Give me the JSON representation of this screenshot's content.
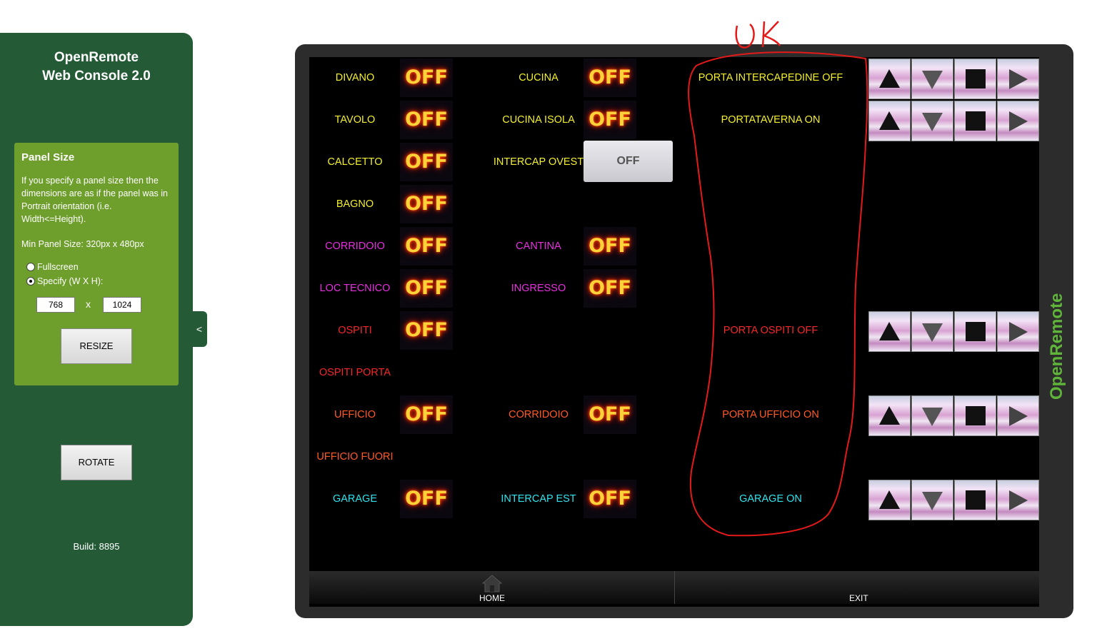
{
  "sidebar": {
    "title_line1": "OpenRemote",
    "title_line2": "Web Console 2.0",
    "panel_size": {
      "heading": "Panel Size",
      "description": "If you specify a panel size then the dimensions are as if the panel was in Portrait orientation (i.e. Width<=Height).",
      "min_size": "Min Panel Size: 320px x 480px",
      "option_fullscreen": "Fullscreen",
      "option_specify": "Specify (W X H):",
      "selected_option": "Specify (W X H):",
      "width_value": "768",
      "height_value": "1024",
      "times": "x",
      "resize_label": "RESIZE"
    },
    "rotate_label": "ROTATE",
    "build": "Build: 8895",
    "collapse_glyph": "<"
  },
  "rows": [
    {
      "color": "#f3ef2e",
      "left": {
        "label": "DIVANO",
        "state": "OFF"
      },
      "mid": {
        "label": "CUCINA",
        "state": "OFF"
      },
      "door": {
        "label": "PORTA INTERCAPEDINE OFF"
      },
      "controls": true
    },
    {
      "color": "#f3ef2e",
      "left": {
        "label": "TAVOLO",
        "state": "OFF"
      },
      "mid": {
        "label": "CUCINA ISOLA",
        "state": "OFF"
      },
      "door": {
        "label": "PORTATAVERNA ON"
      },
      "controls": true
    },
    {
      "color": "#f3ef2e",
      "left": {
        "label": "CALCETTO",
        "state": "OFF"
      },
      "mid": {
        "label": "INTERCAP OVEST",
        "state": "OFF",
        "style": "grey"
      }
    },
    {
      "color": "#f3ef2e",
      "left": {
        "label": "BAGNO",
        "state": "OFF"
      }
    },
    {
      "color": "#e82ee0",
      "left": {
        "label": "CORRIDOIO",
        "state": "OFF"
      },
      "mid": {
        "label": "CANTINA",
        "state": "OFF"
      }
    },
    {
      "color": "#e82ee0",
      "left": {
        "label": "LOC TECNICO",
        "state": "OFF"
      },
      "mid": {
        "label": "INGRESSO",
        "state": "OFF"
      }
    },
    {
      "color": "#f5262a",
      "left": {
        "label": "OSPITI",
        "state": "OFF"
      },
      "door": {
        "label": "PORTA OSPITI OFF"
      },
      "controls": true
    },
    {
      "color": "#f5262a",
      "left": {
        "label": "OSPITI PORTA"
      }
    },
    {
      "color": "#ff5a26",
      "left": {
        "label": "UFFICIO",
        "state": "OFF"
      },
      "mid": {
        "label": "CORRIDOIO",
        "state": "OFF"
      },
      "door": {
        "label": "PORTA UFFICIO ON"
      },
      "controls": true
    },
    {
      "color": "#ff5a26",
      "left": {
        "label": "UFFICIO FUORI"
      }
    },
    {
      "color": "#2ee4ee",
      "left": {
        "label": "GARAGE",
        "state": "OFF"
      },
      "mid": {
        "label": "INTERCAP EST",
        "state": "OFF"
      },
      "door": {
        "label": "GARAGE ON"
      },
      "controls": true
    }
  ],
  "control_icons": [
    "up-arrow-icon",
    "down-arrow-icon",
    "stop-icon",
    "play-icon"
  ],
  "bottom_nav": {
    "home_label": "HOME",
    "exit_label": "EXIT"
  },
  "logo_text": "OpenRemote",
  "annotation_text": "OK",
  "colors": {
    "sidebar": "#245a36",
    "panel_box": "#6e9e2c",
    "annotation": "#e41a1a"
  }
}
